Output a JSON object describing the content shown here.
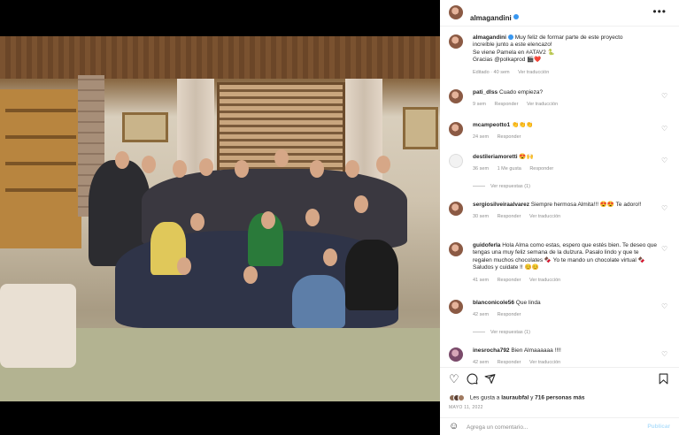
{
  "post": {
    "author": "almagandini",
    "caption_lines": [
      "Muy feliz de formar parte de este proyecto",
      "increíble junto a este elencazo!",
      "Se viene Pamela en #ATAV2 🐍",
      "Gracias @polkaprod 🎬❤️"
    ],
    "caption_meta": {
      "status": "Editado",
      "time": "40 sem",
      "translate": "Ver traducción"
    }
  },
  "comments": [
    {
      "user": "pati_dlss",
      "text": "Cuado empieza?",
      "time": "9 sem",
      "reply": "Responder",
      "translate": "Ver traducción"
    },
    {
      "user": "mcampeotto1",
      "text": "👏👏👏",
      "time": "24 sem",
      "reply": "Responder"
    },
    {
      "user": "destileriamoretti",
      "text": "😍🙌",
      "time": "36 sem",
      "likes": "1 Me gusta",
      "reply": "Responder",
      "view_replies": "Ver respuestas (1)"
    },
    {
      "user": "sergiosilveiraalvarez",
      "text": "Siempre hermosa Almita!!! 😍😍 Te adoro!!",
      "time": "30 sem",
      "reply": "Responder",
      "translate": "Ver traducción"
    },
    {
      "user": "guidoferla",
      "text": "Hola Alma como estas, espero que estés bien. Te deseo que tengas una muy feliz semana de la dulzura. Pasalo lindo y que te regalen muchos chocolates 🍫 Yo te mando un chocolate virtual 🍫 Saludos y cuidate !! 😊😊",
      "time": "41 sem",
      "reply": "Responder",
      "translate": "Ver traducción"
    },
    {
      "user": "blanconicole56",
      "text": "Que linda",
      "time": "42 sem",
      "reply": "Responder",
      "view_replies": "Ver respuestas (1)"
    },
    {
      "user": "inesrocha792",
      "text": "Bien Almaaaaaa !!!!",
      "time": "42 sem",
      "reply": "Responder",
      "translate": "Ver traducción"
    }
  ],
  "likes": {
    "prefix": "Les gusta a",
    "user": "lauraubfal",
    "connector": "y",
    "others": "716 personas más"
  },
  "date": "MAYO 11, 2022",
  "add_comment": {
    "placeholder": "Agrega un comentario...",
    "publish": "Publicar"
  },
  "icons": {
    "like": "heart-icon",
    "comment": "comment-icon",
    "share": "share-icon",
    "save": "bookmark-icon",
    "more": "more-icon",
    "emoji": "emoji-icon"
  },
  "colors": {
    "link": "#00376b",
    "verified": "#3897f0",
    "muted": "#8e8e8e",
    "publish": "#b2dffc"
  }
}
